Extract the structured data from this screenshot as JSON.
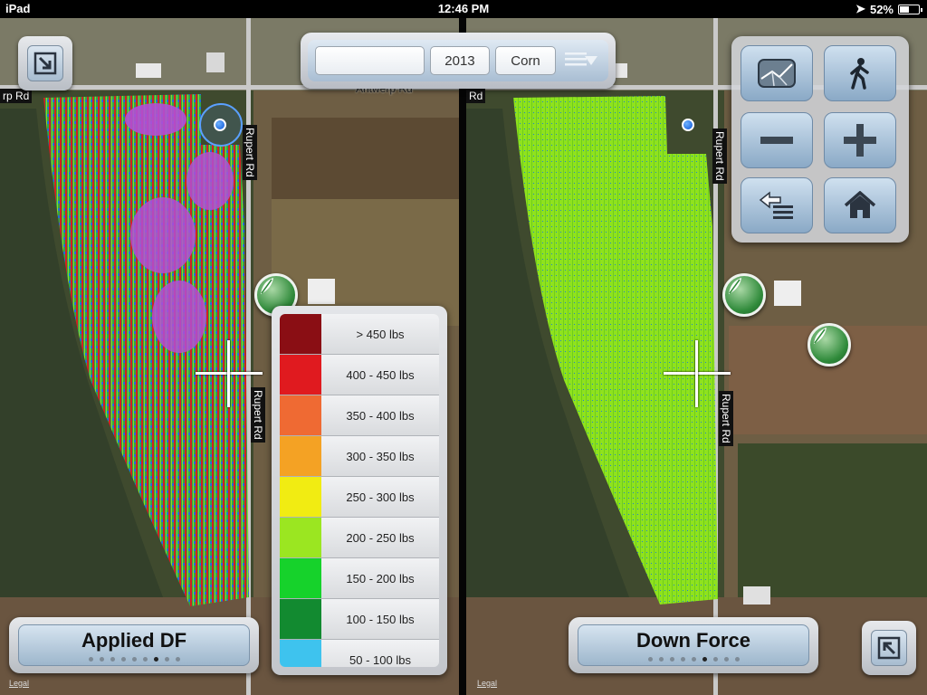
{
  "status_bar": {
    "device": "iPad",
    "time": "12:46 PM",
    "battery": "52%",
    "battery_level": 0.52
  },
  "toolbar": {
    "field_name": "",
    "year": "2013",
    "crop": "Corn"
  },
  "roads": {
    "left": {
      "top_road": "rp Rd",
      "center_road": "Antwerp Rd",
      "vertical_1": "Rupert Rd",
      "vertical_2": "Rupert Rd"
    },
    "right": {
      "top_road": "Rd",
      "vertical_1": "Rupert Rd",
      "vertical_2": "Rupert Rd"
    }
  },
  "legend": {
    "items": [
      {
        "label": "> 450 lbs",
        "color": "#8a0e14"
      },
      {
        "label": "400 - 450 lbs",
        "color": "#e01a1f"
      },
      {
        "label": "350 - 400 lbs",
        "color": "#ef6a33"
      },
      {
        "label": "300 - 350 lbs",
        "color": "#f4a224"
      },
      {
        "label": "250 - 300 lbs",
        "color": "#f1ec12"
      },
      {
        "label": "200 - 250 lbs",
        "color": "#9be621"
      },
      {
        "label": "150 - 200 lbs",
        "color": "#16d22b"
      },
      {
        "label": "100 - 150 lbs",
        "color": "#128a30"
      },
      {
        "label": "50 - 100 lbs",
        "color": "#3ec3ee"
      }
    ]
  },
  "layers": {
    "left": {
      "title": "Applied DF",
      "page_count": 9,
      "active_page": 7
    },
    "right": {
      "title": "Down Force",
      "page_count": 9,
      "active_page": 6
    }
  },
  "legal": "Legal",
  "icons": {
    "expand": "expand-icon",
    "collapse": "collapse-icon",
    "map_style": "map-style-icon",
    "walk": "walk-icon",
    "zoom_out": "minus-icon",
    "zoom_in": "plus-icon",
    "layers": "layers-icon",
    "home": "home-icon",
    "flag": "flag-icon",
    "menu": "menu-dropdown-icon"
  }
}
